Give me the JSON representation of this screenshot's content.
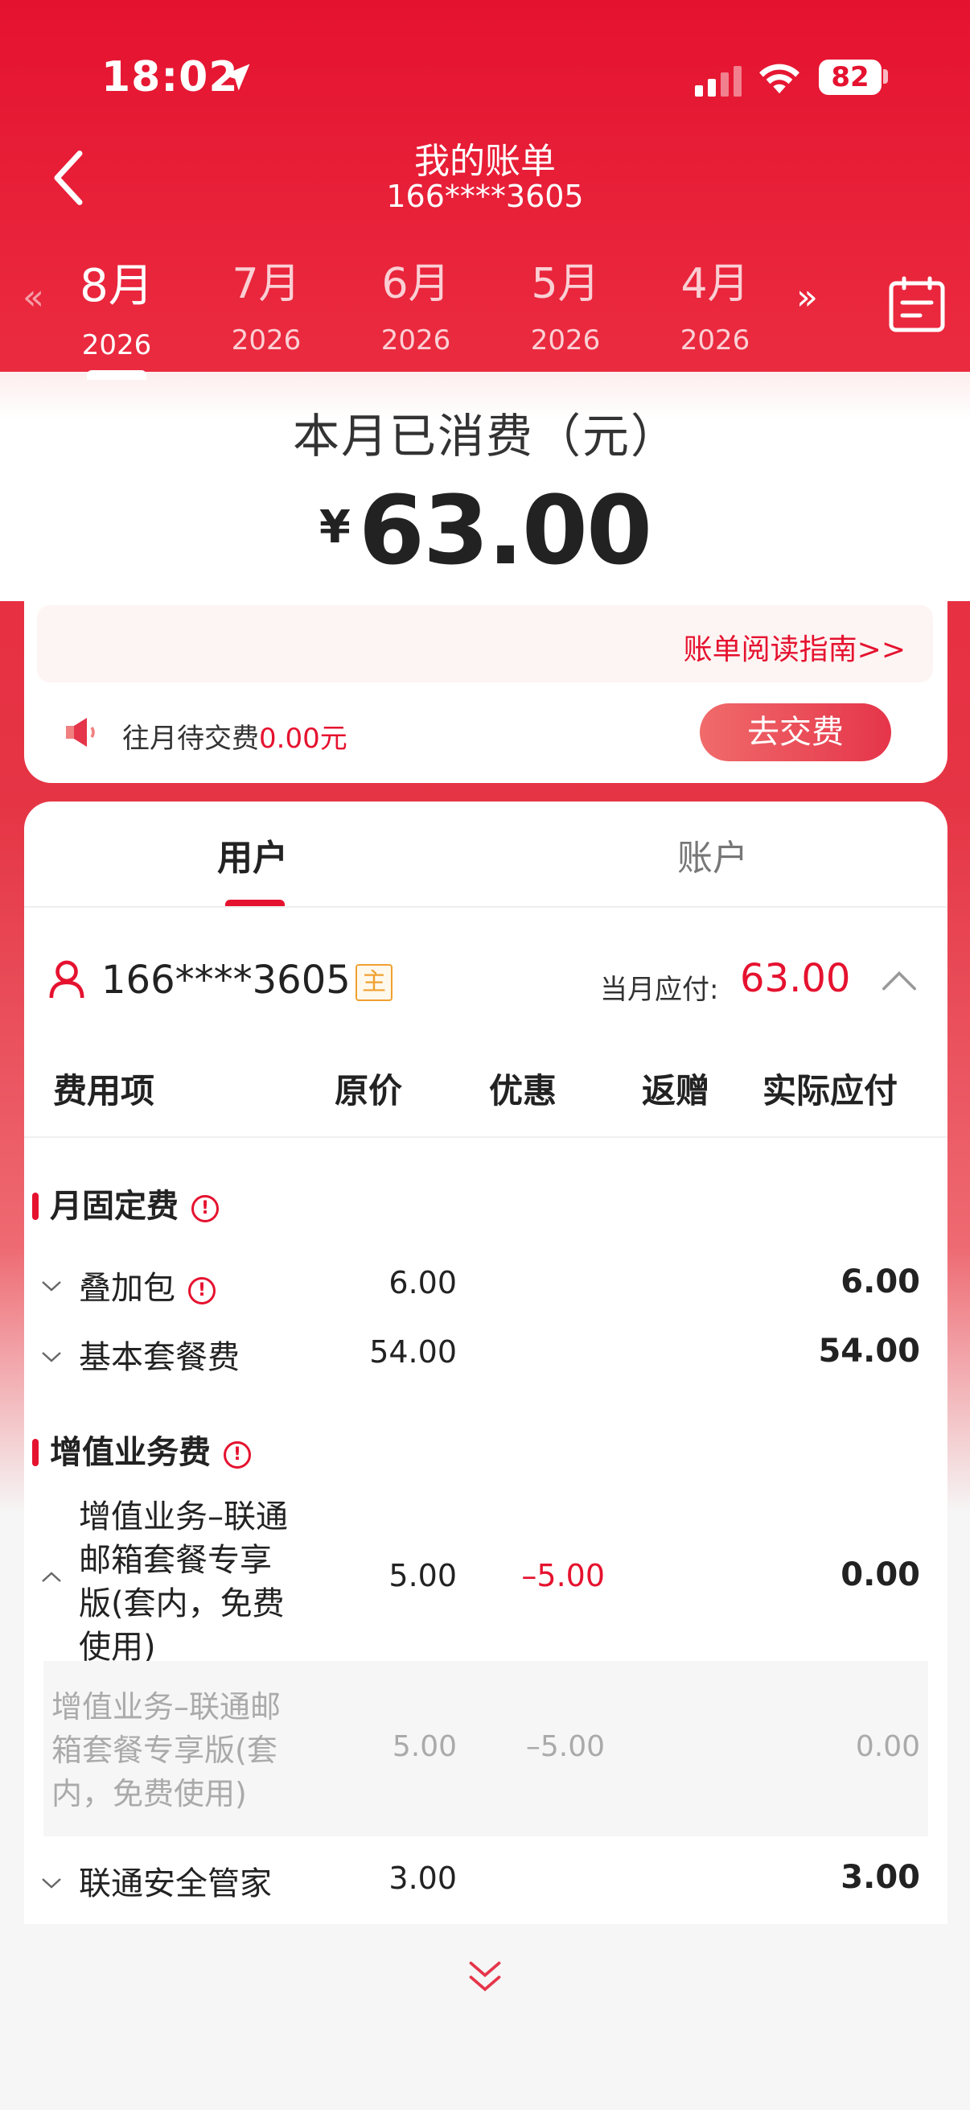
{
  "status_bar": {
    "time": "18:02",
    "battery": "82"
  },
  "header": {
    "title": "我的账单",
    "subtitle": "166****3605"
  },
  "months": [
    {
      "month": "8月",
      "year": "2026",
      "active": true
    },
    {
      "month": "7月",
      "year": "2026",
      "active": false
    },
    {
      "month": "6月",
      "year": "2026",
      "active": false
    },
    {
      "month": "5月",
      "year": "2026",
      "active": false
    },
    {
      "month": "4月",
      "year": "2026",
      "active": false
    }
  ],
  "nav_arrows": {
    "prev": "«",
    "next": "»"
  },
  "summary": {
    "title": "本月已消费（元）",
    "currency": "¥",
    "amount": "63.00",
    "guide_link": "账单阅读指南>>",
    "pending_label": "往月待交费",
    "pending_value": "0.00元",
    "pay_button": "去交费"
  },
  "tabs": {
    "user": "用户",
    "account": "账户"
  },
  "user_row": {
    "phone": "166****3605",
    "badge": "主",
    "due_label": "当月应付:",
    "due_value": "63.00"
  },
  "table": {
    "headers": [
      "费用项",
      "原价",
      "优惠",
      "返赠",
      "实际应付"
    ],
    "groups": [
      {
        "name": "月固定费",
        "info": "!"
      },
      {
        "name": "增值业务费",
        "info": "!"
      }
    ],
    "rows": [
      {
        "name": "叠加包",
        "info": "!",
        "orig": "6.00",
        "disc": "",
        "actual": "6.00"
      },
      {
        "name": "基本套餐费",
        "orig": "54.00",
        "disc": "",
        "actual": "54.00"
      },
      {
        "name": "增值业务–联通邮箱套餐专享版(套内，免费使用)",
        "orig": "5.00",
        "disc": "–5.00",
        "actual": "0.00"
      },
      {
        "name": "联通安全管家",
        "orig": "3.00",
        "disc": "",
        "actual": "3.00"
      }
    ],
    "sub_row": {
      "name": "增值业务–联通邮箱套餐专享版(套内，免费使用)",
      "orig": "5.00",
      "disc": "–5.00",
      "actual": "0.00"
    }
  },
  "colors": {
    "brand": "#e5122f"
  },
  "icons": [
    "location-arrow-icon",
    "signal-icon",
    "wifi-icon",
    "back-icon",
    "calendar-icon",
    "speaker-icon",
    "user-icon",
    "chevron-up-icon",
    "chevron-down-icon",
    "info-icon",
    "double-chevron-down-icon"
  ]
}
